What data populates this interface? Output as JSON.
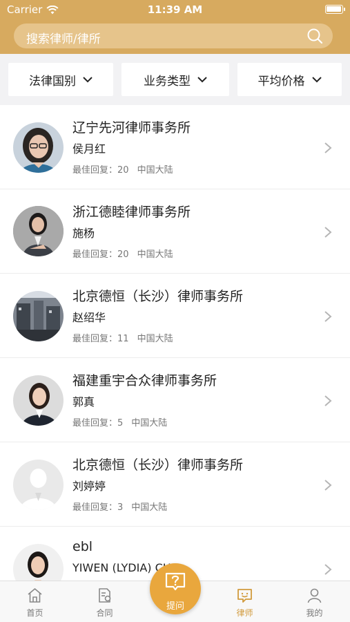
{
  "status_bar": {
    "carrier": "Carrier",
    "time": "11:39 AM",
    "battery_level": 1.0
  },
  "search": {
    "placeholder": "搜索律师/律所"
  },
  "filters": [
    {
      "label": "法律国别"
    },
    {
      "label": "业务类型"
    },
    {
      "label": "平均价格"
    }
  ],
  "lawyers": [
    {
      "firm": "辽宁先河律师事务所",
      "name": "侯月红",
      "best_reply_label": "最佳回复：",
      "best_reply_count": "20",
      "region": "中国大陆"
    },
    {
      "firm": "浙江德睦律师事务所",
      "name": "施杨",
      "best_reply_label": "最佳回复：",
      "best_reply_count": "20",
      "region": "中国大陆"
    },
    {
      "firm": "北京德恒（长沙）律师事务所",
      "name": "赵绍华",
      "best_reply_label": "最佳回复：",
      "best_reply_count": "11",
      "region": "中国大陆"
    },
    {
      "firm": "福建重宇合众律师事务所",
      "name": "郭真",
      "best_reply_label": "最佳回复：",
      "best_reply_count": "5",
      "region": "中国大陆"
    },
    {
      "firm": "北京德恒（长沙）律师事务所",
      "name": "刘婷婷",
      "best_reply_label": "最佳回复：",
      "best_reply_count": "3",
      "region": "中国大陆"
    },
    {
      "firm": "ebl",
      "name": "YIWEN (LYDIA) CH"
    }
  ],
  "tabbar": {
    "tabs": [
      {
        "label": "首页",
        "icon": "home-icon"
      },
      {
        "label": "合同",
        "icon": "contract-icon"
      },
      {
        "label": "律师",
        "icon": "lawyer-icon",
        "active": true
      },
      {
        "label": "我的",
        "icon": "profile-icon"
      }
    ],
    "ask": {
      "label": "提问",
      "icon": "question-icon"
    }
  },
  "colors": {
    "brand": "#d7aa5f",
    "search_bg": "#e6c48b",
    "accent": "#d19a3c",
    "ask_button": "#e9a73d"
  }
}
